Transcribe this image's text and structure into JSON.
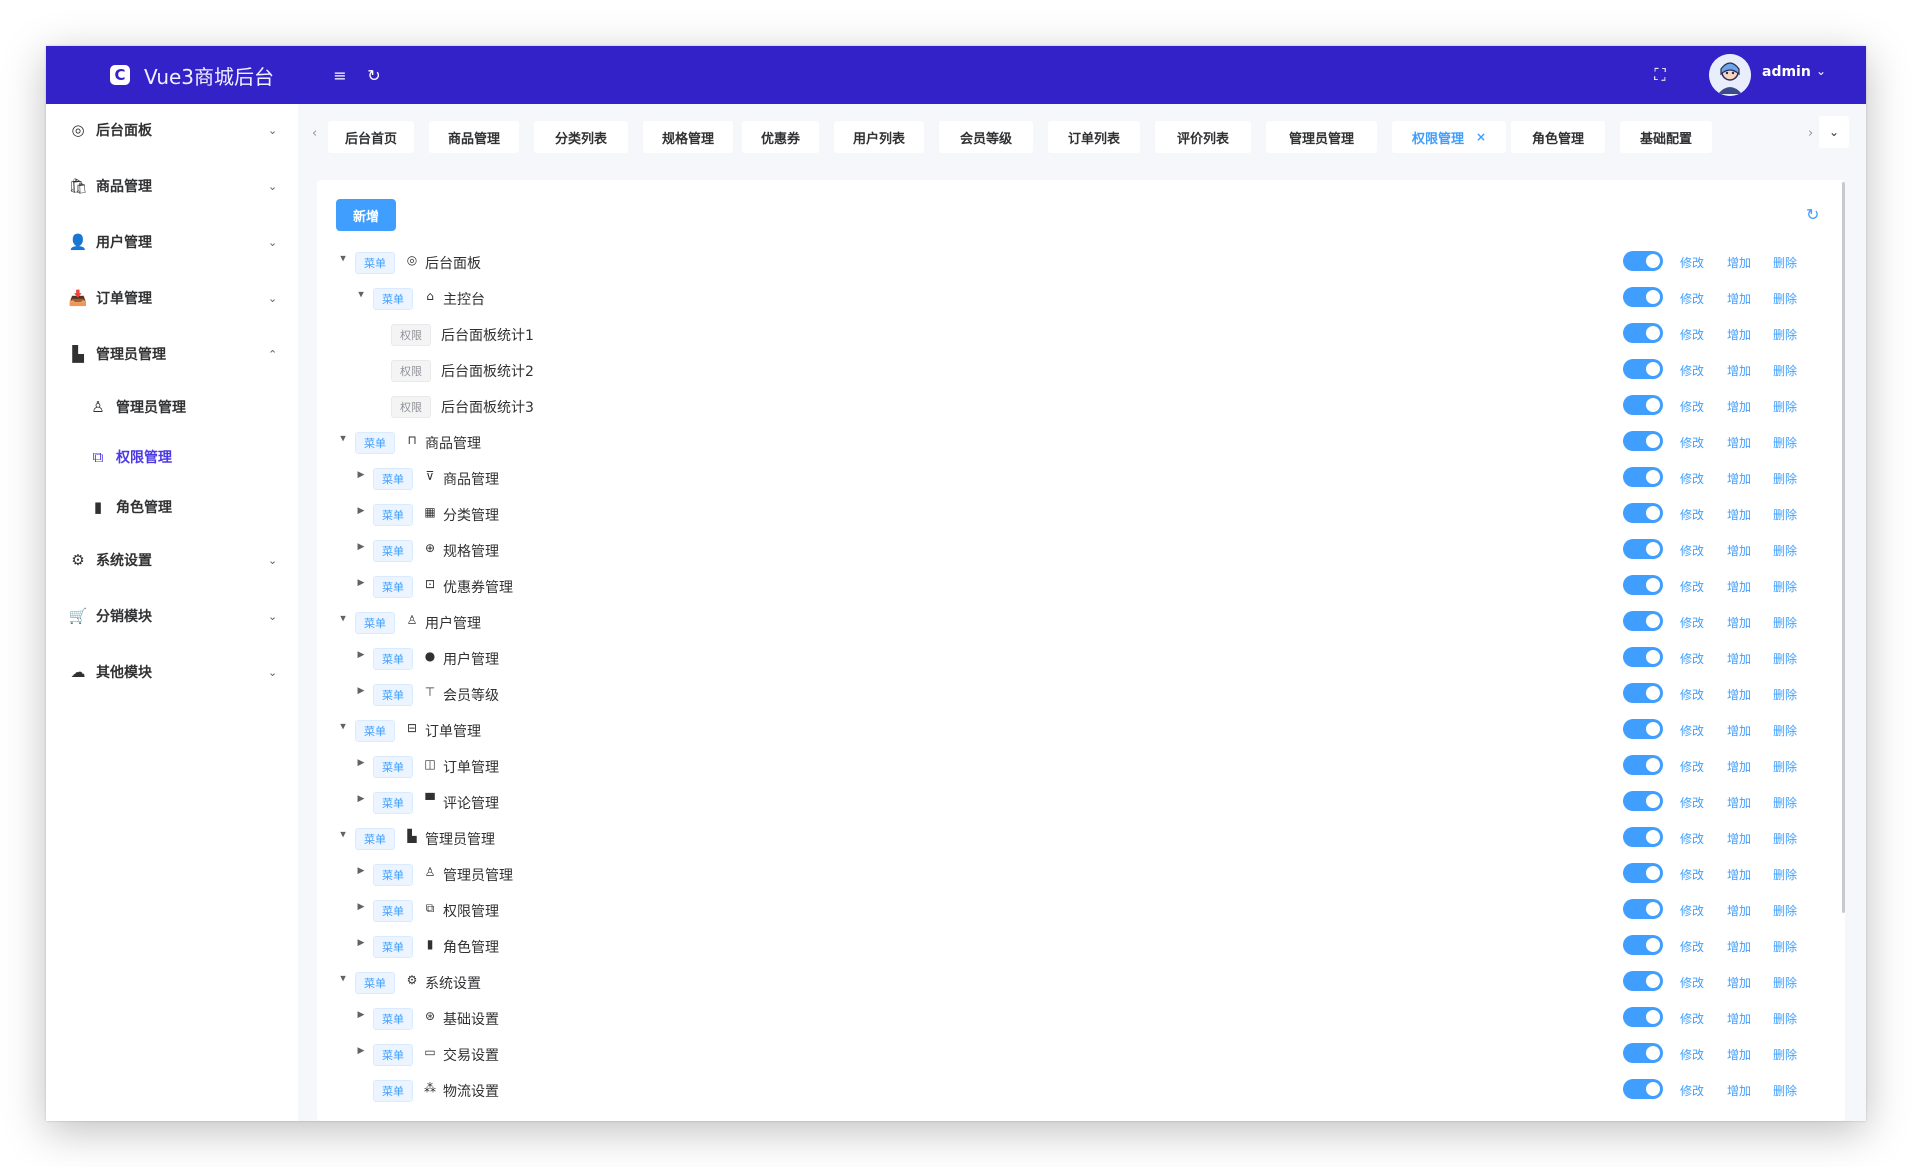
{
  "header": {
    "logo_glyph": "C",
    "title": "Vue3商城后台",
    "menu_toggle_icon": "≡",
    "reload_icon": "↻",
    "fullscreen_icon": "⛶",
    "user_name": "admin",
    "caret": "⌄",
    "accent": "#3422c9"
  },
  "sidebar": {
    "items": [
      {
        "name": "sidebar-item-dashboard",
        "icon": "dashboard-icon",
        "glyph": "◎",
        "label": "后台面板",
        "arrow": "⌄"
      },
      {
        "name": "sidebar-item-goods",
        "icon": "bag-icon",
        "glyph": "🛍",
        "label": "商品管理",
        "arrow": "⌄"
      },
      {
        "name": "sidebar-item-users",
        "icon": "user-icon",
        "glyph": "👤",
        "label": "用户管理",
        "arrow": "⌄"
      },
      {
        "name": "sidebar-item-orders",
        "icon": "inbox-icon",
        "glyph": "📥",
        "label": "订单管理",
        "arrow": "⌄"
      },
      {
        "name": "sidebar-item-admins",
        "icon": "office-icon",
        "glyph": "▙",
        "label": "管理员管理",
        "arrow": "⌃"
      },
      {
        "name": "sidebar-subitem-admin",
        "icon": "avatar-icon",
        "glyph": "♙",
        "label": "管理员管理",
        "arrow": ""
      },
      {
        "name": "sidebar-subitem-permission",
        "icon": "connection-icon",
        "glyph": "⧉",
        "label": "权限管理",
        "arrow": ""
      },
      {
        "name": "sidebar-subitem-role",
        "icon": "histogram-icon",
        "glyph": "▮",
        "label": "角色管理",
        "arrow": ""
      },
      {
        "name": "sidebar-item-settings",
        "icon": "setting-icon",
        "glyph": "⚙",
        "label": "系统设置",
        "arrow": "⌄"
      },
      {
        "name": "sidebar-item-distribution",
        "icon": "cart-icon",
        "glyph": "🛒",
        "label": "分销模块",
        "arrow": "⌄"
      },
      {
        "name": "sidebar-item-other",
        "icon": "cloud-icon",
        "glyph": "☁",
        "label": "其他模块",
        "arrow": "⌄"
      }
    ]
  },
  "tabs": {
    "prev_arrow": "‹",
    "next_arrow": "›",
    "dropdown_icon": "⌄",
    "close_icon": "×",
    "items": [
      {
        "label": "后台首页",
        "active": false
      },
      {
        "label": "商品管理",
        "active": false
      },
      {
        "label": "分类列表",
        "active": false
      },
      {
        "label": "规格管理",
        "active": false
      },
      {
        "label": "优惠券",
        "active": false
      },
      {
        "label": "用户列表",
        "active": false
      },
      {
        "label": "会员等级",
        "active": false
      },
      {
        "label": "订单列表",
        "active": false
      },
      {
        "label": "评价列表",
        "active": false
      },
      {
        "label": "管理员管理",
        "active": false
      },
      {
        "label": "权限管理",
        "active": true
      },
      {
        "label": "角色管理",
        "active": false
      },
      {
        "label": "基础配置",
        "active": false
      }
    ]
  },
  "toolbar": {
    "add_label": "新增",
    "refresh_icon": "↻"
  },
  "tree": {
    "menu_tag": "菜单",
    "perm_tag": "权限",
    "actions": {
      "edit": "修改",
      "add": "增加",
      "delete": "删除"
    },
    "expanded_caret": "▼",
    "collapsed_caret": "▶",
    "rows": [
      {
        "level": 0,
        "type": "menu",
        "caret": "expanded",
        "icon": "dashboard-icon",
        "glyph": "◎",
        "label": "后台面板",
        "enabled": true
      },
      {
        "level": 1,
        "type": "menu",
        "caret": "expanded",
        "icon": "home-icon",
        "glyph": "⌂",
        "label": "主控台",
        "enabled": true
      },
      {
        "level": 2,
        "type": "perm",
        "caret": "none",
        "icon": "",
        "glyph": "",
        "label": "后台面板统计1",
        "enabled": true
      },
      {
        "level": 2,
        "type": "perm",
        "caret": "none",
        "icon": "",
        "glyph": "",
        "label": "后台面板统计2",
        "enabled": true
      },
      {
        "level": 2,
        "type": "perm",
        "caret": "none",
        "icon": "",
        "glyph": "",
        "label": "后台面板统计3",
        "enabled": true
      },
      {
        "level": 0,
        "type": "menu",
        "caret": "expanded",
        "icon": "bag-icon",
        "glyph": "⊓",
        "label": "商品管理",
        "enabled": true
      },
      {
        "level": 1,
        "type": "menu",
        "caret": "collapsed",
        "icon": "shopping-cart-icon",
        "glyph": "⊽",
        "label": "商品管理",
        "enabled": true
      },
      {
        "level": 1,
        "type": "menu",
        "caret": "collapsed",
        "icon": "grid-icon",
        "glyph": "▦",
        "label": "分类管理",
        "enabled": true
      },
      {
        "level": 1,
        "type": "menu",
        "caret": "collapsed",
        "icon": "aim-icon",
        "glyph": "⊕",
        "label": "规格管理",
        "enabled": true
      },
      {
        "level": 1,
        "type": "menu",
        "caret": "collapsed",
        "icon": "ticket-icon",
        "glyph": "⊡",
        "label": "优惠券管理",
        "enabled": true
      },
      {
        "level": 0,
        "type": "menu",
        "caret": "expanded",
        "icon": "user-icon",
        "glyph": "♙",
        "label": "用户管理",
        "enabled": true
      },
      {
        "level": 1,
        "type": "menu",
        "caret": "collapsed",
        "icon": "user-filled-icon",
        "glyph": "●",
        "label": "用户管理",
        "enabled": true
      },
      {
        "level": 1,
        "type": "menu",
        "caret": "collapsed",
        "icon": "level-icon",
        "glyph": "⊤",
        "label": "会员等级",
        "enabled": true
      },
      {
        "level": 0,
        "type": "menu",
        "caret": "expanded",
        "icon": "inbox-icon",
        "glyph": "⊟",
        "label": "订单管理",
        "enabled": true
      },
      {
        "level": 1,
        "type": "menu",
        "caret": "collapsed",
        "icon": "notebook-icon",
        "glyph": "◫",
        "label": "订单管理",
        "enabled": true
      },
      {
        "level": 1,
        "type": "menu",
        "caret": "collapsed",
        "icon": "comment-icon",
        "glyph": "▀",
        "label": "评论管理",
        "enabled": true
      },
      {
        "level": 0,
        "type": "menu",
        "caret": "expanded",
        "icon": "office-icon",
        "glyph": "▙",
        "label": "管理员管理",
        "enabled": true
      },
      {
        "level": 1,
        "type": "menu",
        "caret": "collapsed",
        "icon": "avatar-icon",
        "glyph": "♙",
        "label": "管理员管理",
        "enabled": true
      },
      {
        "level": 1,
        "type": "menu",
        "caret": "collapsed",
        "icon": "connection-icon",
        "glyph": "⧉",
        "label": "权限管理",
        "enabled": true
      },
      {
        "level": 1,
        "type": "menu",
        "caret": "collapsed",
        "icon": "histogram-icon",
        "glyph": "▮",
        "label": "角色管理",
        "enabled": true
      },
      {
        "level": 0,
        "type": "menu",
        "caret": "expanded",
        "icon": "setting-icon",
        "glyph": "⚙",
        "label": "系统设置",
        "enabled": true
      },
      {
        "level": 1,
        "type": "menu",
        "caret": "collapsed",
        "icon": "tools-icon",
        "glyph": "⊛",
        "label": "基础设置",
        "enabled": true
      },
      {
        "level": 1,
        "type": "menu",
        "caret": "collapsed",
        "icon": "credit-card-icon",
        "glyph": "▭",
        "label": "交易设置",
        "enabled": true
      },
      {
        "level": 1,
        "type": "menu",
        "caret": "none",
        "icon": "share-icon",
        "glyph": "⁂",
        "label": "物流设置",
        "enabled": true
      }
    ]
  }
}
